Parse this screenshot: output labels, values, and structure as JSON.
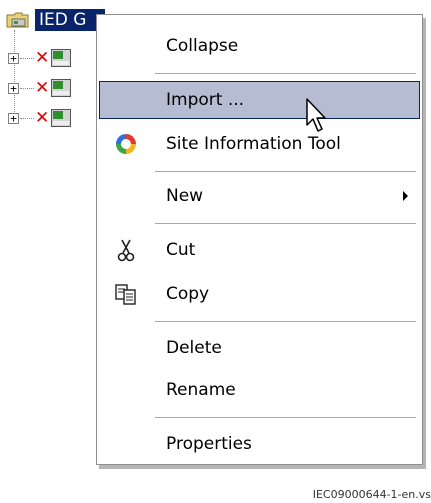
{
  "tree": {
    "root_label": "IED G",
    "rows": [
      {
        "expander": "+"
      },
      {
        "expander": "+"
      },
      {
        "expander": "+"
      }
    ]
  },
  "context_menu": {
    "items": [
      {
        "label": "Collapse"
      },
      {
        "label": "Import ..."
      },
      {
        "label": "Site Information Tool",
        "icon": "site-information-tool-icon"
      },
      {
        "label": "New",
        "submenu": true
      },
      {
        "label": "Cut",
        "icon": "scissors-icon"
      },
      {
        "label": "Copy",
        "icon": "copy-icon"
      },
      {
        "label": "Delete"
      },
      {
        "label": "Rename"
      },
      {
        "label": "Properties"
      }
    ],
    "hovered_item": "Import ..."
  },
  "caption": "IEC09000644-1-en.vs",
  "colors": {
    "selection": "#0a246a",
    "hover_background": "#b6bdd2",
    "error_x": "#e00000"
  }
}
